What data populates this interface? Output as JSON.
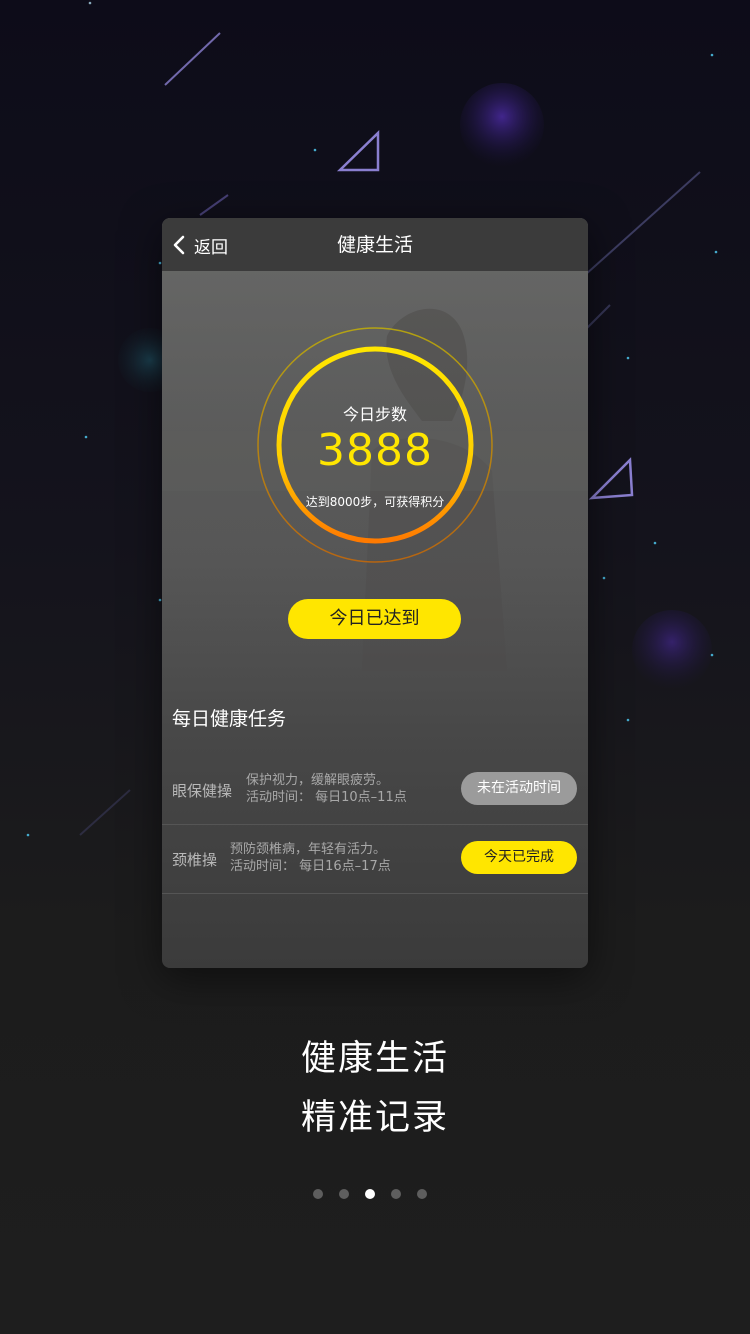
{
  "card": {
    "back_label": "返回",
    "title": "健康生活",
    "steps": {
      "label": "今日步数",
      "value": "3888",
      "hint": "达到8000步，可获得积分"
    },
    "reach_button": "今日已达到",
    "section_title": "每日健康任务",
    "tasks": [
      {
        "name": "眼保健操",
        "desc1": "保护视力，缓解眼疲劳。",
        "desc2": "活动时间：  每日10点–11点",
        "button": "未在活动时间",
        "button_state": "inactive"
      },
      {
        "name": "颈椎操",
        "desc1": "预防颈椎病，年轻有活力。",
        "desc2": "活动时间：  每日16点–17点",
        "button": "今天已完成",
        "button_state": "completed"
      }
    ]
  },
  "slogan": {
    "line1": "健康生活",
    "line2": "精准记录"
  },
  "pager": {
    "count": 5,
    "active_index": 2
  },
  "colors": {
    "accent": "#ffe600",
    "ring_start": "#ffe600",
    "ring_end": "#ff7a00",
    "inactive_button": "#9b9b9b"
  }
}
